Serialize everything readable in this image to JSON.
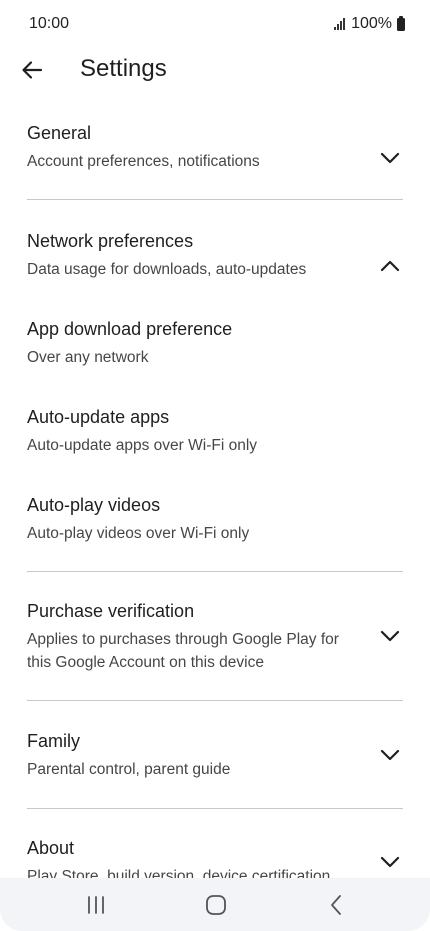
{
  "status": {
    "time": "10:00",
    "battery": "100%"
  },
  "header": {
    "title": "Settings"
  },
  "sections": {
    "general": {
      "title": "General",
      "subtitle": "Account preferences, notifications"
    },
    "network": {
      "title": "Network preferences",
      "subtitle": "Data usage for downloads, auto-updates"
    },
    "app_download": {
      "title": "App download preference",
      "subtitle": "Over any network"
    },
    "auto_update": {
      "title": "Auto-update apps",
      "subtitle": "Auto-update apps over Wi-Fi only"
    },
    "auto_play": {
      "title": "Auto-play videos",
      "subtitle": "Auto-play videos over Wi-Fi only"
    },
    "purchase": {
      "title": "Purchase verification",
      "subtitle_line1": "Applies to purchases through Google Play for",
      "subtitle_line2": "this Google Account on this device"
    },
    "family": {
      "title": "Family",
      "subtitle": "Parental control, parent guide"
    },
    "about": {
      "title": "About",
      "subtitle": "Play Store, build version, device certification"
    }
  },
  "icons": {
    "back": "arrow-back-icon",
    "expand": "chevron-down-icon",
    "collapse": "chevron-up-icon",
    "recents": "recents-icon",
    "home": "home-icon",
    "nav_back": "nav-back-icon"
  }
}
